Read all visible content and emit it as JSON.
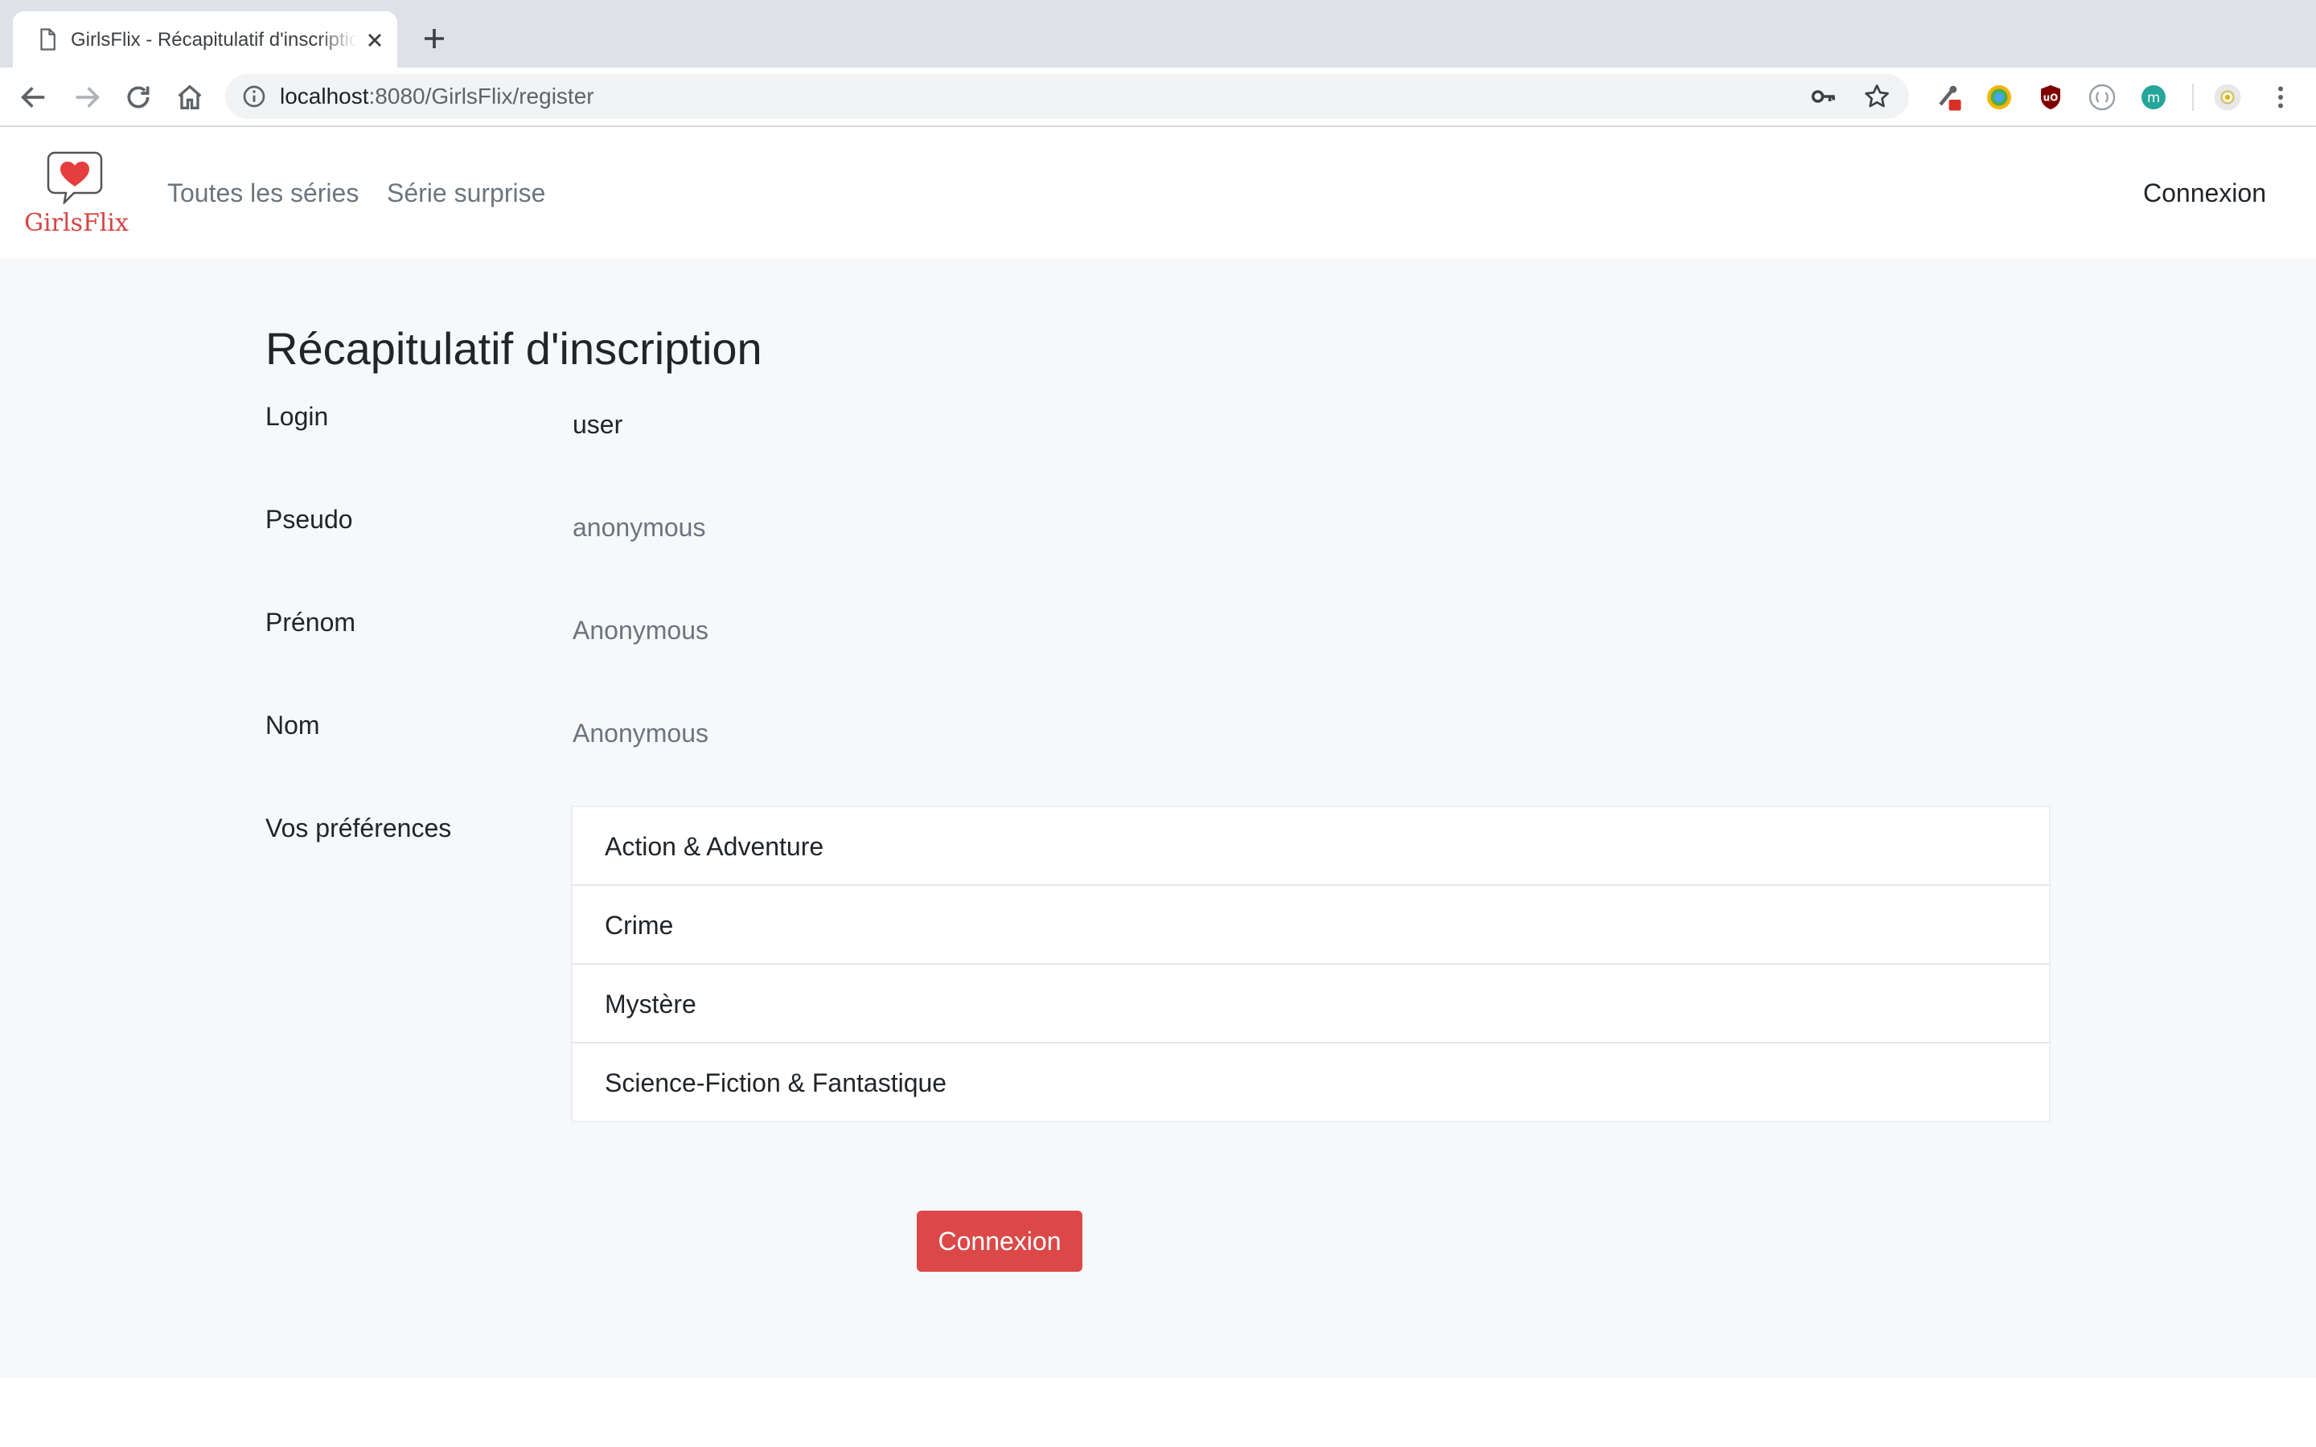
{
  "browser": {
    "tab_title": "GirlsFlix - Récapitulatif d'inscription",
    "url_host": "localhost",
    "url_rest": ":8080/GirlsFlix/register",
    "icons": [
      "page-icon",
      "close-icon",
      "plus-icon",
      "back-icon",
      "forward-icon",
      "reload-icon",
      "home-icon",
      "info-icon",
      "key-icon",
      "star-icon",
      "extension-icon",
      "profile-icon",
      "menu-icon"
    ]
  },
  "navbar": {
    "brand": "GirlsFlix",
    "links": [
      "Toutes les séries",
      "Série surprise"
    ],
    "right_link": "Connexion",
    "brand_color": "#d94343"
  },
  "summary": {
    "title": "Récapitulatif d'inscription",
    "fields": [
      {
        "label": "Login",
        "value": "user"
      },
      {
        "label": "Pseudo",
        "value": "anonymous"
      },
      {
        "label": "Prénom",
        "value": "Anonymous"
      },
      {
        "label": "Nom",
        "value": "Anonymous"
      }
    ],
    "preferences_label": "Vos préférences",
    "preferences": [
      "Action & Adventure",
      "Crime",
      "Mystère",
      "Science-Fiction & Fantastique"
    ],
    "button_label": "Connexion",
    "button_color": "#dc4848"
  }
}
